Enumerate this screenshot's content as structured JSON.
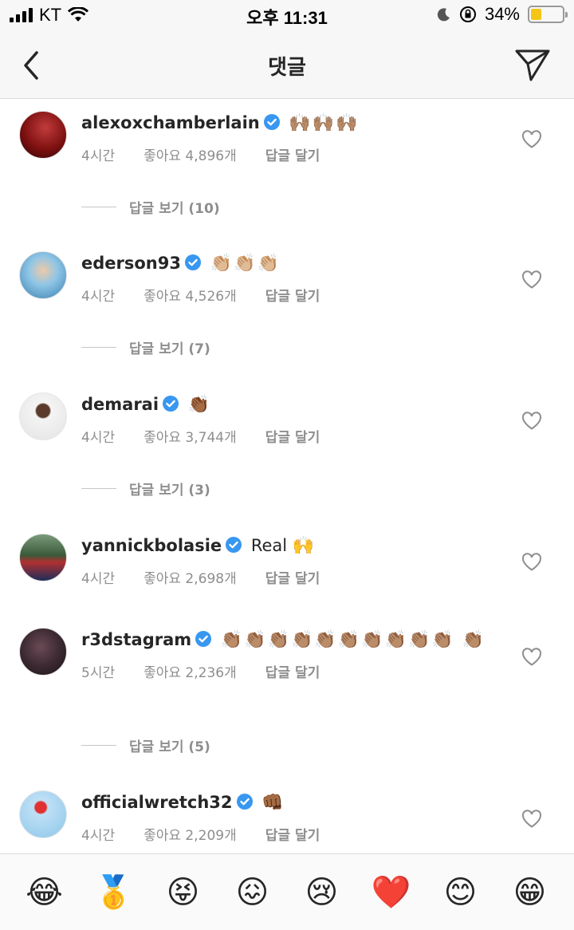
{
  "status_bar": {
    "carrier": "KT",
    "time": "오후 11:31",
    "battery": "34%"
  },
  "header": {
    "title": "댓글"
  },
  "comments": [
    {
      "username": "alexoxchamberlain",
      "text": "",
      "emoji": "🙌🏽🙌🏽🙌🏽",
      "time": "4시간",
      "likes": "좋아요 4,896개",
      "reply": "답글 달기",
      "view_replies": "답글 보기 (10)",
      "avatar_color": "#8b1a1a"
    },
    {
      "username": "ederson93",
      "text": "",
      "emoji": "👏🏼👏🏼👏🏼",
      "time": "4시간",
      "likes": "좋아요 4,526개",
      "reply": "답글 달기",
      "view_replies": "답글 보기 (7)",
      "avatar_color": "#6fb0d8"
    },
    {
      "username": "demarai",
      "text": "",
      "emoji": "👏🏾",
      "time": "4시간",
      "likes": "좋아요 3,744개",
      "reply": "답글 달기",
      "view_replies": "답글 보기 (3)",
      "avatar_color": "#e9e9e9"
    },
    {
      "username": "yannickbolasie",
      "text": "Real",
      "emoji": "🙌",
      "time": "4시간",
      "likes": "좋아요 2,698개",
      "reply": "답글 달기",
      "view_replies": "",
      "avatar_color": "#3a5a3a"
    },
    {
      "username": "r3dstagram",
      "text": "",
      "emoji": "👏🏽👏🏽👏🏽👏🏽👏🏽👏🏽👏🏽👏🏽👏🏽👏🏽 👏🏽",
      "time": "5시간",
      "likes": "좋아요 2,236개",
      "reply": "답글 달기",
      "view_replies": "답글 보기 (5)",
      "avatar_color": "#3d2a33"
    },
    {
      "username": "officialwretch32",
      "text": "",
      "emoji": "👊🏾",
      "time": "4시간",
      "likes": "좋아요 2,209개",
      "reply": "답글 달기",
      "view_replies": "",
      "avatar_color": "#a9d3ef"
    }
  ],
  "emoji_bar": [
    "😂",
    "🥇",
    "😝",
    "😖",
    "😢",
    "❤️",
    "😊",
    "😁"
  ],
  "colors": {
    "verified": "#3897f0",
    "meta_text": "#8e8e8e",
    "heart_stroke": "#8e8e8e"
  }
}
